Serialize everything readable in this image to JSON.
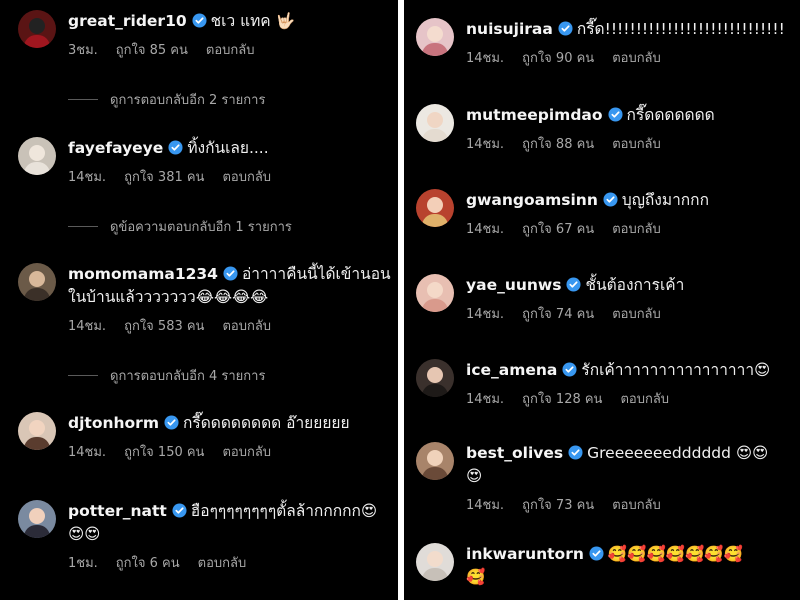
{
  "left_comments": [
    {
      "username": "great_rider10",
      "text": "ชเว แทค 🤟🏻",
      "time": "3ชม.",
      "likes": "ถูกใจ 85 คน",
      "reply": "ตอบกลับ",
      "avatar_bg": "#5a1414",
      "avatar_face": "#222",
      "avatar_body": "#a0161f"
    },
    {
      "username": "fayefayeye",
      "text": "ทิ้งกันเลย....",
      "time": "14ชม.",
      "likes": "ถูกใจ 381 คน",
      "reply": "ตอบกลับ",
      "avatar_bg": "#c9c2b8",
      "avatar_face": "#efe6dc",
      "avatar_body": "#e8e2da"
    },
    {
      "username": "momomama1234",
      "text": "อ่าาาาคืนนี้ได้เข้านอน",
      "text2": "ในบ้านแล้ววววววว😂😂😂😂",
      "time": "14ชม.",
      "likes": "ถูกใจ 583 คน",
      "reply": "ตอบกลับ",
      "avatar_bg": "#6b5a48",
      "avatar_face": "#d8b89a",
      "avatar_body": "#3b3028"
    },
    {
      "username": "djtonhorm",
      "text": "กรี๊ดดดดดดดด อ๊ายยยยย",
      "time": "14ชม.",
      "likes": "ถูกใจ 150 คน",
      "reply": "ตอบกลับ",
      "avatar_bg": "#d9c6b6",
      "avatar_face": "#f1d4c0",
      "avatar_body": "#5a3c2e"
    },
    {
      "username": "potter_natt",
      "text": "ฮือๆๆๆๆๆๆๆๆตั้ลล้ากกกกก😍",
      "text2": "😍😍",
      "time": "1ชม.",
      "likes": "ถูกใจ 6 คน",
      "reply": "ตอบกลับ",
      "avatar_bg": "#7a8aa0",
      "avatar_face": "#f0d0bc",
      "avatar_body": "#2b2b38"
    }
  ],
  "left_more": [
    {
      "label": "ดูการตอบกลับอีก 2 รายการ"
    },
    {
      "label": "ดูข้อความตอบกลับอีก 1 รายการ"
    },
    {
      "label": "ดูการตอบกลับอีก 4 รายการ"
    }
  ],
  "right_comments": [
    {
      "username": "nuisujiraa",
      "text": "กรี๊ด!!!!!!!!!!!!!!!!!!!!!!!!!!!!!",
      "time": "14ชม.",
      "likes": "ถูกใจ 90 คน",
      "reply": "ตอบกลับ",
      "avatar_bg": "#e6c4c8",
      "avatar_face": "#f4dccf",
      "avatar_body": "#c8747e"
    },
    {
      "username": "mutmeepimdao",
      "text": "กรี๊ดดดดดดด",
      "time": "14ชม.",
      "likes": "ถูกใจ 88 คน",
      "reply": "ตอบกลับ",
      "avatar_bg": "#ece8e2",
      "avatar_face": "#f0d6c4",
      "avatar_body": "#e4dbd0"
    },
    {
      "username": "gwangoamsinn",
      "text": "บุญถึงมากกก",
      "time": "14ชม.",
      "likes": "ถูกใจ 67 คน",
      "reply": "ตอบกลับ",
      "avatar_bg": "#b8422e",
      "avatar_face": "#f3cfb8",
      "avatar_body": "#e0b16a"
    },
    {
      "username": "yae_uunws",
      "text": "ชั้นต้องการเค้า",
      "time": "14ชม.",
      "likes": "ถูกใจ 74 คน",
      "reply": "ตอบกลับ",
      "avatar_bg": "#e8bfb2",
      "avatar_face": "#f4d9c8",
      "avatar_body": "#d99a8c"
    },
    {
      "username": "ice_amena",
      "text": "รักเค้าาาาาาาาาาาาาาาา😍",
      "time": "14ชม.",
      "likes": "ถูกใจ 128 คน",
      "reply": "ตอบกลับ",
      "avatar_bg": "#3a302c",
      "avatar_face": "#e6c6b2",
      "avatar_body": "#1e1a18"
    },
    {
      "username": "best_olives",
      "text": "Greeeeeeedddddd 😍😍",
      "text2": "😍",
      "time": "14ชม.",
      "likes": "ถูกใจ 73 คน",
      "reply": "ตอบกลับ",
      "avatar_bg": "#a8846a",
      "avatar_face": "#f0d2ba",
      "avatar_body": "#6a4a38"
    },
    {
      "username": "inkwaruntorn",
      "text": "🥰🥰🥰🥰🥰🥰🥰",
      "text2": "🥰",
      "time": "",
      "likes": "",
      "reply": "",
      "avatar_bg": "#e0dcd8",
      "avatar_face": "#f2dccc",
      "avatar_body": "#c7c0b8"
    }
  ],
  "colors": {
    "background": "#000000",
    "verified": "#3897f0",
    "meta": "#a8a8a8",
    "divider": "#ffffff"
  },
  "icons": {
    "verified": "verified-badge-icon"
  }
}
